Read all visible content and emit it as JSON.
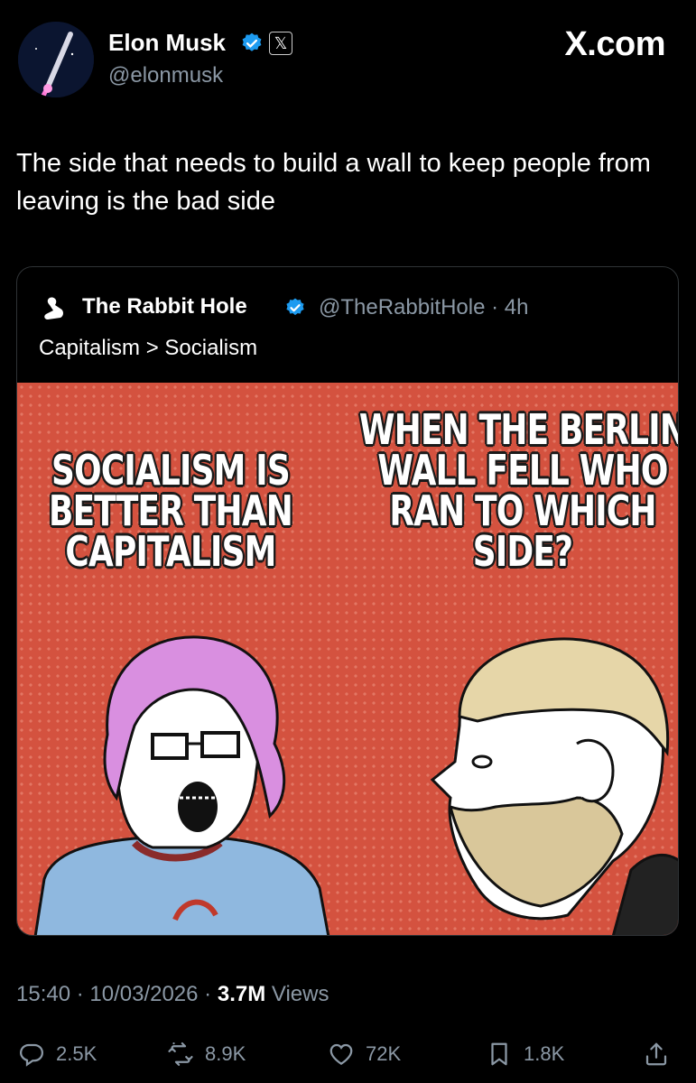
{
  "author": {
    "display_name": "Elon Musk",
    "handle": "@elonmusk",
    "affiliate_badge": "𝕏",
    "avatar_icon": "rocket-avatar"
  },
  "brand_label": "X.com",
  "tweet": {
    "text": "The side that needs to build a wall to keep people from leaving is the bad side"
  },
  "quoted": {
    "author_name": "The Rabbit Hole",
    "handle_time": "@TheRabbitHole · 4h",
    "text": "Capitalism > Socialism",
    "meme": {
      "left_caption": "SOCIALISM IS BETTER THAN CAPITALISM",
      "right_caption": "WHEN THE BERLIN WALL FELL WHO RAN TO WHICH SIDE?"
    }
  },
  "meta": {
    "time_date": "15:40 · 10/03/2026 · ",
    "views_count": "3.7M",
    "views_label": " Views"
  },
  "actions": {
    "replies": "2.5K",
    "reposts": "8.9K",
    "likes": "72K",
    "bookmarks": "1.8K"
  },
  "colors": {
    "background": "#000000",
    "verified_blue": "#1d9bf0",
    "meme_red": "#d4523f",
    "muted_text": "#8b98a5"
  }
}
